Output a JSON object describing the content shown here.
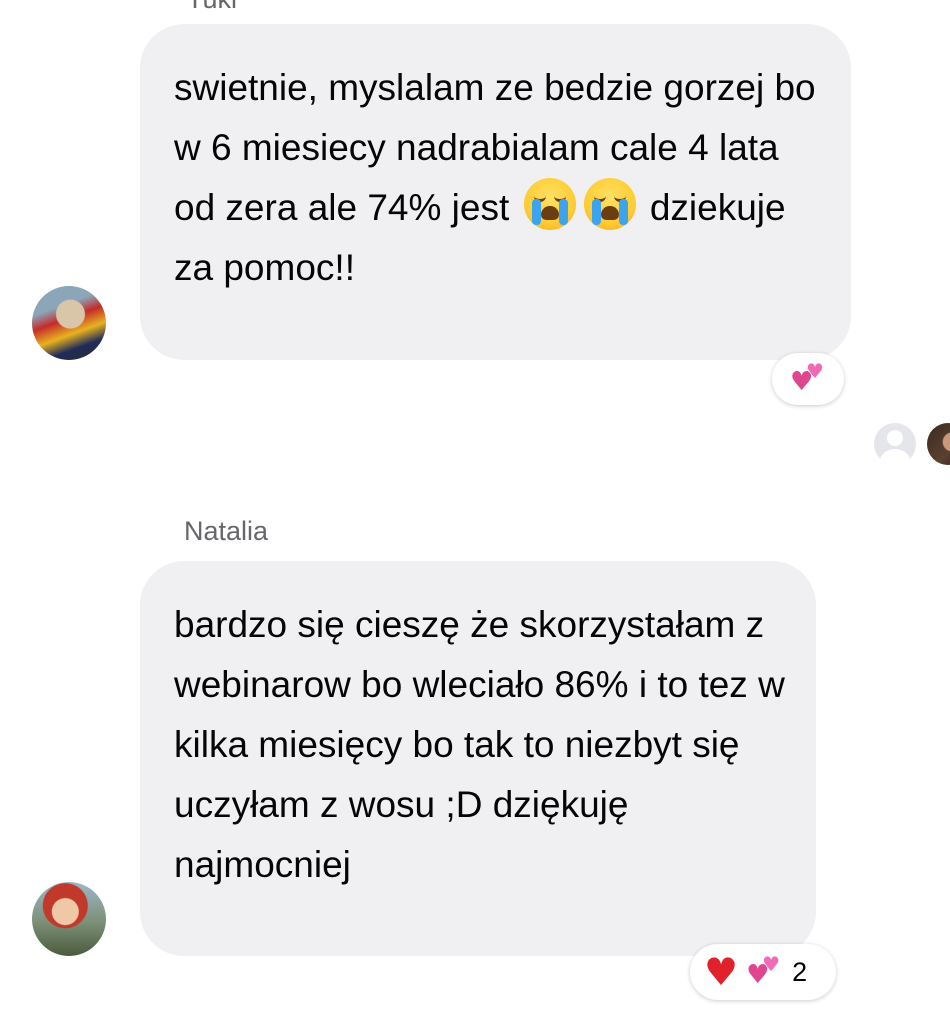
{
  "messages": [
    {
      "sender": "Yuki",
      "text_before": "swietnie, myslalam ze bedzie gorzej bo w 6 miesiecy nadrabialam cale 4 lata od zera ale 74% jest ",
      "inline_emojis": [
        "loudly-crying-face",
        "loudly-crying-face"
      ],
      "text_after": " dziekuje za pomoc!!",
      "reactions": [
        {
          "icon": "two-hearts"
        }
      ]
    },
    {
      "sender": "Natalia",
      "text": "bardzo się cieszę że skorzystałam z webinarow bo wleciało 86% i to tez w kilka miesięcy bo tak to niezbyt się uczyłam z wosu ;D dziękuję najmocniej",
      "reactions": [
        {
          "icon": "red-heart"
        },
        {
          "icon": "two-hearts"
        }
      ],
      "reaction_count": "2"
    }
  ],
  "seen_by": [
    {
      "icon": "default-avatar"
    },
    {
      "icon": "photo-avatar"
    }
  ],
  "colors": {
    "bubble_bg": "#f0f0f3",
    "name_text": "#65676b",
    "message_text": "#050505",
    "heart_red": "#e0232a",
    "heart_pink": "#ec4fa8"
  }
}
